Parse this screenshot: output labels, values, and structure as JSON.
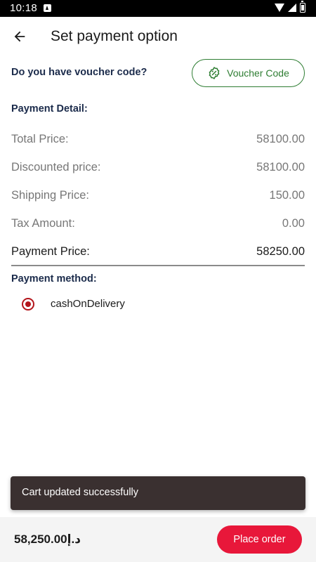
{
  "status_bar": {
    "time": "10:18",
    "icons": [
      "notification-a-icon",
      "wifi-icon",
      "signal-icon",
      "battery-icon"
    ]
  },
  "header": {
    "back_icon": "arrow-back-icon",
    "title": "Set payment option"
  },
  "voucher": {
    "question": "Do you have voucher code?",
    "button_label": "Voucher Code",
    "button_icon": "discount-badge-icon",
    "accent_color": "#2e7d32"
  },
  "payment_detail": {
    "heading": "Payment Detail:",
    "rows": [
      {
        "label": "Total Price:",
        "value": "58100.00"
      },
      {
        "label": "Discounted price:",
        "value": "58100.00"
      },
      {
        "label": "Shipping Price:",
        "value": "150.00"
      },
      {
        "label": "Tax Amount:",
        "value": "0.00"
      }
    ],
    "total": {
      "label": "Payment Price:",
      "value": "58250.00"
    }
  },
  "payment_method": {
    "heading": "Payment method:",
    "options": [
      {
        "label": "cashOnDelivery",
        "selected": true
      }
    ],
    "radio_color": "#b3151b"
  },
  "snackbar": {
    "message": "Cart updated successfully"
  },
  "footer": {
    "total": "58,250.00د.إ",
    "place_order_label": "Place order",
    "button_color": "#e8173a"
  }
}
